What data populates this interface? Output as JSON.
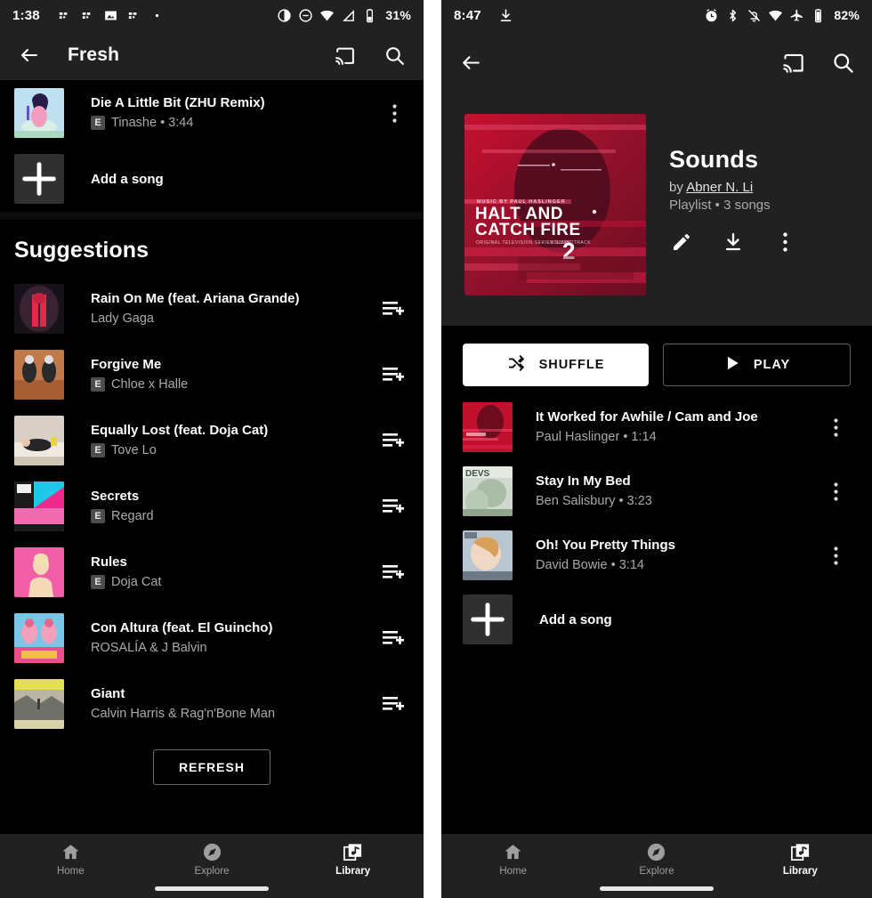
{
  "left_phone": {
    "status_bar": {
      "time": "1:38",
      "battery_percent": "31%",
      "left_icons": [
        "app-notification-icon",
        "app-notification-icon",
        "photos-icon",
        "app-notification-icon",
        "more-dot-icon"
      ],
      "right_icons": [
        "do-not-disturb-icon",
        "minus-circle-icon",
        "wifi-icon",
        "signal-icon",
        "battery-icon"
      ]
    },
    "app_bar": {
      "back_label": "back-arrow",
      "title": "Fresh",
      "cast_label": "cast",
      "search_label": "search"
    },
    "playlist_songs": [
      {
        "title": "Die A Little Bit (ZHU Remix)",
        "explicit": "E",
        "artist": "Tinashe",
        "duration": "3:44",
        "subtitle": "Tinashe • 3:44",
        "art": "tinashe-art"
      }
    ],
    "add_song_label": "Add a song",
    "section_title": "Suggestions",
    "suggestions": [
      {
        "title": "Rain On Me (feat. Ariana Grande)",
        "explicit": "",
        "artist": "Lady Gaga",
        "art": "rain-on-me-art"
      },
      {
        "title": "Forgive Me",
        "explicit": "E",
        "artist": "Chloe x Halle",
        "art": "forgive-me-art"
      },
      {
        "title": "Equally Lost (feat. Doja Cat)",
        "explicit": "E",
        "artist": "Tove Lo",
        "art": "equally-lost-art"
      },
      {
        "title": "Secrets",
        "explicit": "E",
        "artist": "Regard",
        "art": "secrets-art"
      },
      {
        "title": "Rules",
        "explicit": "E",
        "artist": "Doja Cat",
        "art": "rules-art"
      },
      {
        "title": "Con Altura (feat. El Guincho)",
        "explicit": "",
        "artist": "ROSALÍA & J Balvin",
        "art": "con-altura-art"
      },
      {
        "title": "Giant",
        "explicit": "",
        "artist": "Calvin Harris & Rag'n'Bone Man",
        "art": "giant-art"
      }
    ],
    "refresh_label": "REFRESH",
    "bottom_nav": [
      {
        "label": "Home",
        "icon": "home-icon",
        "active": false
      },
      {
        "label": "Explore",
        "icon": "explore-compass-icon",
        "active": false
      },
      {
        "label": "Library",
        "icon": "library-icon",
        "active": true
      }
    ]
  },
  "right_phone": {
    "status_bar": {
      "time": "8:47",
      "battery_percent": "82%",
      "left_icons": [
        "download-icon"
      ],
      "right_icons": [
        "alarm-icon",
        "bluetooth-icon",
        "mute-bell-icon",
        "wifi-icon",
        "airplane-icon",
        "battery-icon"
      ]
    },
    "app_bar": {
      "back_label": "back-arrow",
      "cast_label": "cast",
      "search_label": "search"
    },
    "playlist": {
      "cover_art": "halt-and-catch-fire-volume-2",
      "cover_text_line1": "HALT AND",
      "cover_text_line2": "CATCH FIRE",
      "cover_volume": "2",
      "title": "Sounds",
      "by_prefix": "by ",
      "author": "Abner N. Li",
      "meta": "Playlist • 3 songs",
      "actions": [
        "edit-pencil-icon",
        "download-icon",
        "overflow-menu-icon"
      ]
    },
    "buttons": {
      "shuffle": "SHUFFLE",
      "play": "PLAY"
    },
    "songs": [
      {
        "title": "It Worked for Awhile / Cam and Joe",
        "artist": "Paul Haslinger",
        "duration": "1:14",
        "subtitle": "Paul Haslinger • 1:14",
        "art": "it-worked-art"
      },
      {
        "title": "Stay In My Bed",
        "artist": "Ben Salisbury",
        "duration": "3:23",
        "subtitle": "Ben Salisbury • 3:23",
        "art": "devs-art"
      },
      {
        "title": "Oh! You Pretty Things",
        "artist": "David Bowie",
        "duration": "3:14",
        "subtitle": "David Bowie • 3:14",
        "art": "bowie-art"
      }
    ],
    "add_song_label": "Add a song",
    "bottom_nav": [
      {
        "label": "Home",
        "icon": "home-icon",
        "active": false
      },
      {
        "label": "Explore",
        "icon": "explore-compass-icon",
        "active": false
      },
      {
        "label": "Library",
        "icon": "library-icon",
        "active": true
      }
    ]
  },
  "colors": {
    "surface": "#212121",
    "background": "#000000",
    "accent_red": "#cc0b2e",
    "secondary_text": "#aaaaaa"
  }
}
